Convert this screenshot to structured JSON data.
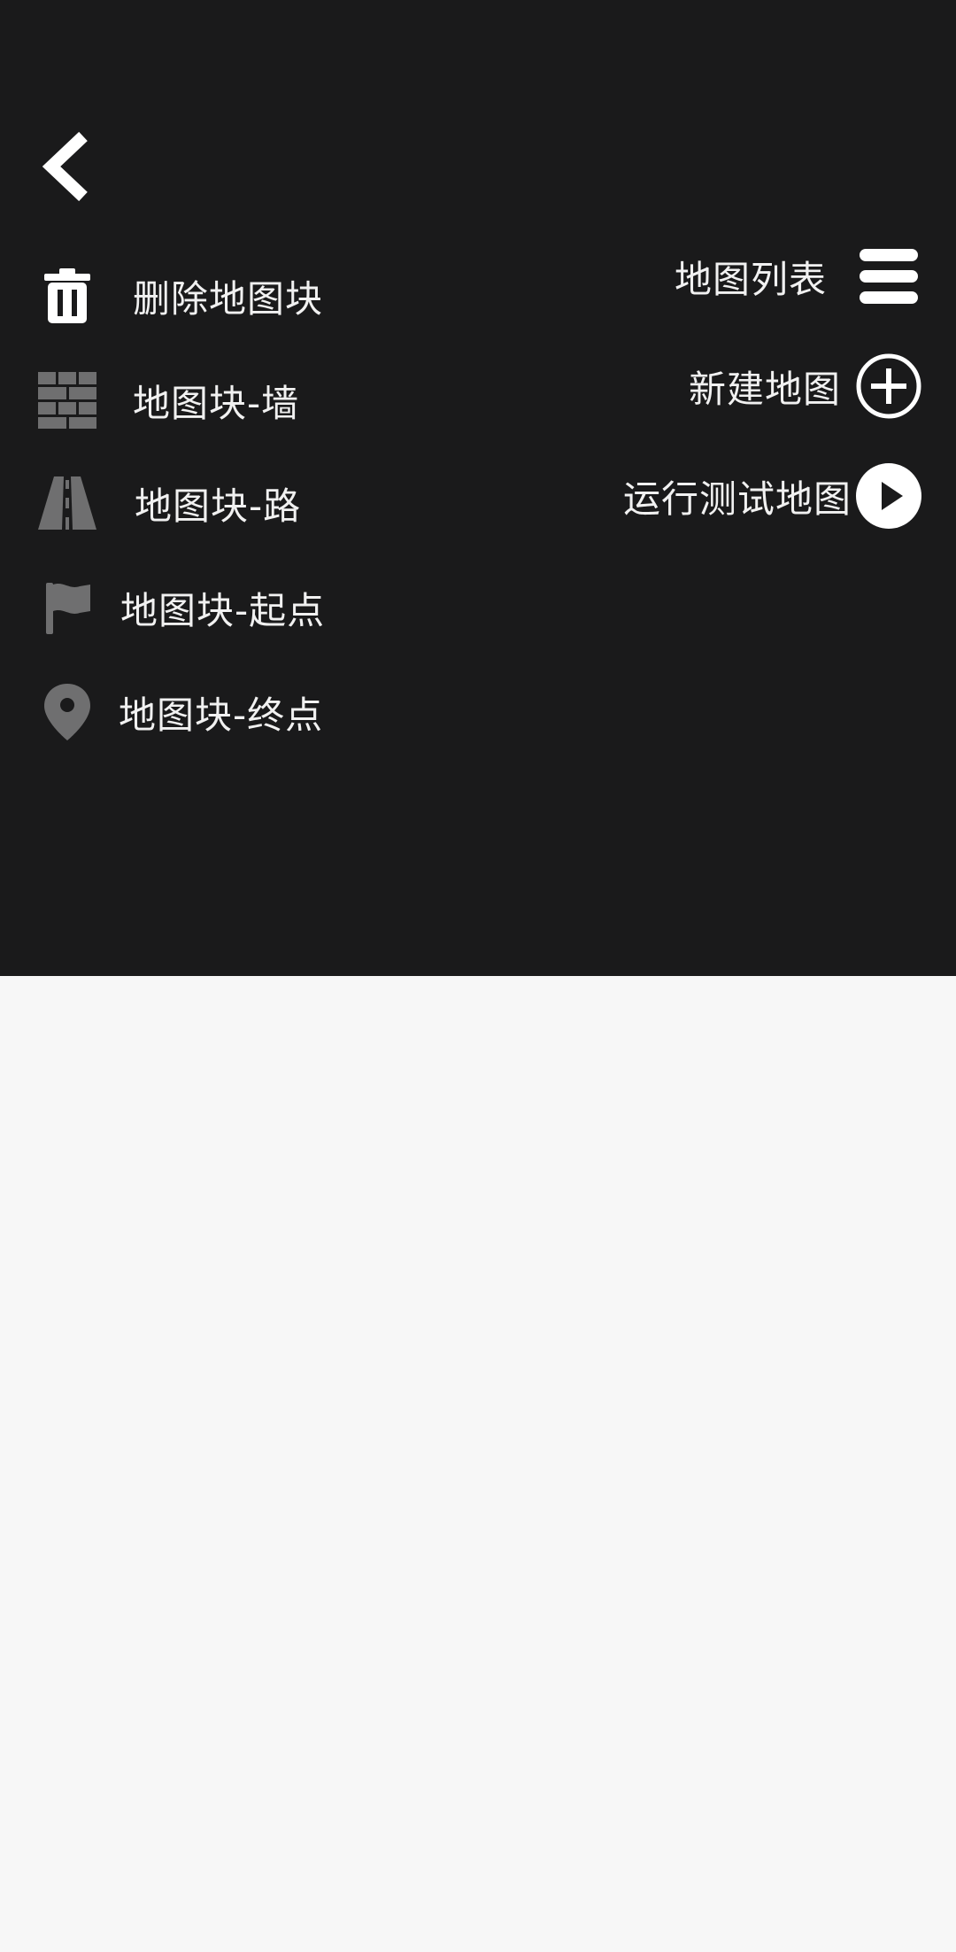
{
  "header": {
    "back_icon": "chevron-left-icon"
  },
  "tools": [
    {
      "label": "删除地图块",
      "icon": "trash-icon"
    },
    {
      "label": "地图块-墙",
      "icon": "brick-wall-icon"
    },
    {
      "label": "地图块-路",
      "icon": "road-icon"
    },
    {
      "label": "地图块-起点",
      "icon": "flag-icon"
    },
    {
      "label": "地图块-终点",
      "icon": "location-pin-icon"
    }
  ],
  "actions": [
    {
      "label": "地图列表",
      "icon": "hamburger-menu-icon"
    },
    {
      "label": "新建地图",
      "icon": "plus-circle-icon"
    },
    {
      "label": "运行测试地图",
      "icon": "play-circle-icon"
    }
  ],
  "colors": {
    "panel_background": "#1a1a1b",
    "canvas_background": "#f7f7f7",
    "text": "#f1f1f1",
    "active_icon": "#ffffff",
    "inactive_icon": "#6f6f70"
  }
}
